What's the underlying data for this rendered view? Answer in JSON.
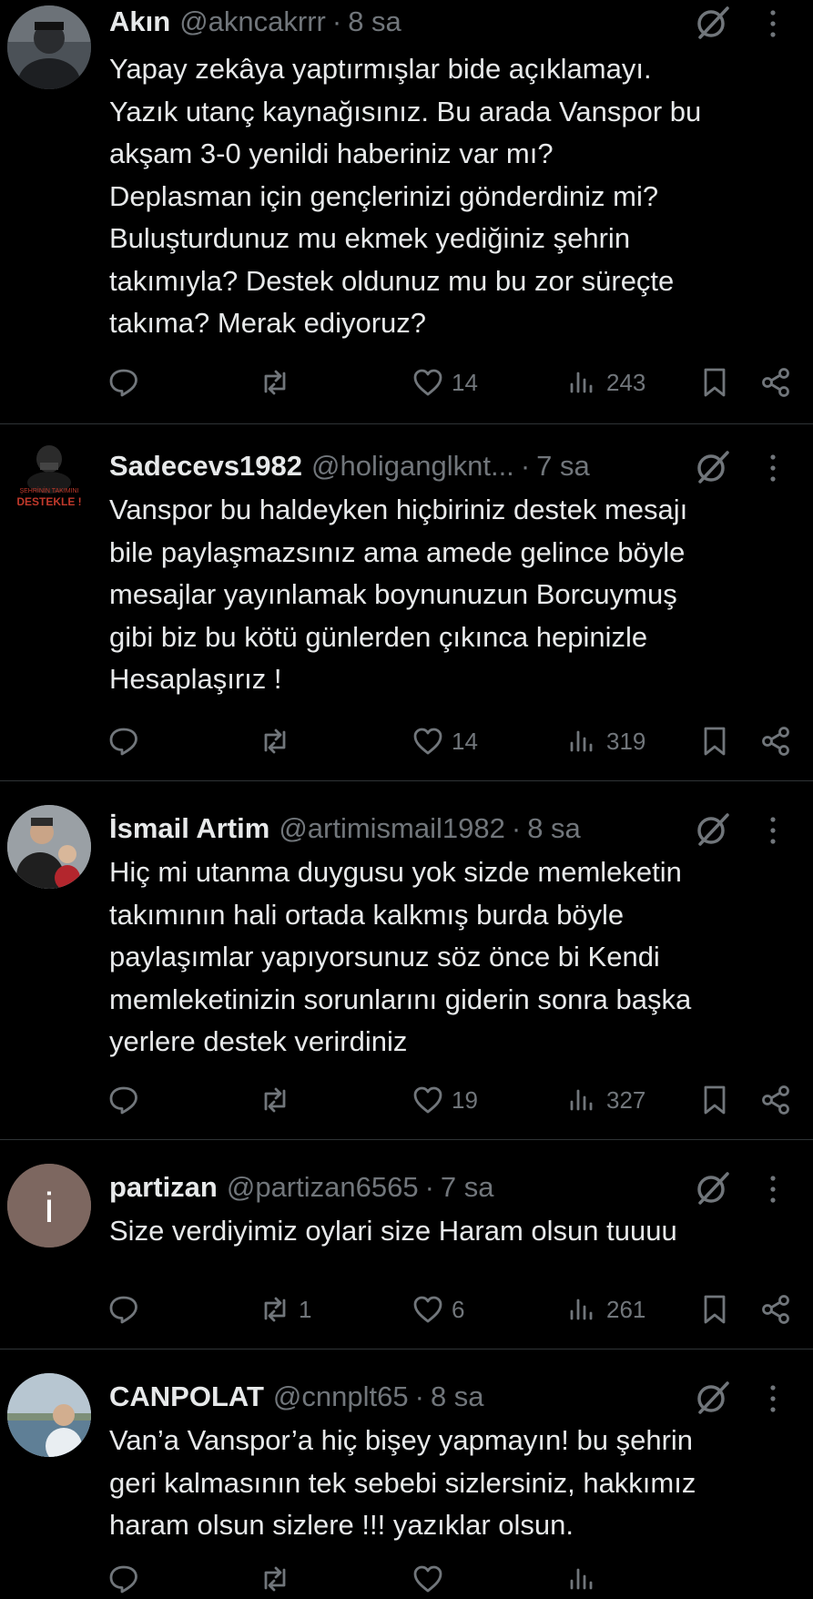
{
  "colors": {
    "background": "#000000",
    "text": "#e7e9ea",
    "secondary": "#71767b",
    "divider": "#2f3336"
  },
  "tweets": [
    {
      "name": "Akın",
      "handle": "@akncakrrr",
      "separator": "·",
      "time": "8 sa",
      "lines": [
        "Yapay zekâya yaptırmışlar bide açıklamayı.",
        "Yazık utanç kaynağısınız. Bu arada Vanspor bu",
        "akşam 3-0 yenildi haberiniz var mı?",
        "Deplasman için gençlerinizi gönderdiniz mi?",
        "Buluşturdunuz mu ekmek yediğiniz şehrin",
        "takımıyla? Destek oldunuz mu bu zor süreçte",
        "takıma? Merak ediyoruz?"
      ],
      "stats": {
        "replies": "",
        "reposts": "",
        "likes": "14",
        "views": "243"
      }
    },
    {
      "name": "Sadecevs1982",
      "handle": "@holiganglknt...",
      "separator": "·",
      "time": "7 sa",
      "lines": [
        "Vanspor bu haldeyken hiçbiriniz destek mesajı",
        "bile paylaşmazsınız ama amede gelince böyle",
        "mesajlar yayınlamak boynunuzun Borcuymuş",
        "gibi biz bu kötü günlerden çıkınca hepinizle",
        "Hesaplaşırız !"
      ],
      "avatar_text": [
        "ŞEHRİNİN TAKIMINI",
        "DESTEKLE !"
      ],
      "stats": {
        "replies": "",
        "reposts": "",
        "likes": "14",
        "views": "319"
      }
    },
    {
      "name": "İsmail Artim",
      "handle": "@artimismail1982",
      "separator": "·",
      "time": "8 sa",
      "lines": [
        "Hiç mi utanma duygusu yok sizde memleketin",
        "takımının hali ortada kalkmış burda böyle",
        "paylaşımlar yapıyorsunuz söz önce bi Kendi",
        "memleketinizin sorunlarını giderin sonra başka",
        "yerlere destek verirdiniz"
      ],
      "stats": {
        "replies": "",
        "reposts": "",
        "likes": "19",
        "views": "327"
      }
    },
    {
      "name": "partizan",
      "handle": "@partizan6565",
      "separator": "·",
      "time": "7 sa",
      "avatar_letter": "i",
      "lines": [
        "Size verdiyimiz oylari size Haram olsun tuuuu"
      ],
      "stats": {
        "replies": "",
        "reposts": "1",
        "likes": "6",
        "views": "261"
      }
    },
    {
      "name": "CANPOLAT",
      "handle": "@cnnplt65",
      "separator": "·",
      "time": "8 sa",
      "lines": [
        "Van’a Vanspor’a hiç bişey yapmayın! bu şehrin",
        "geri kalmasının tek sebebi sizlersiniz, hakkımız",
        "haram olsun sizlere !!! yazıklar olsun."
      ],
      "stats": {
        "replies": "",
        "reposts": "",
        "likes": "",
        "views": ""
      }
    }
  ]
}
